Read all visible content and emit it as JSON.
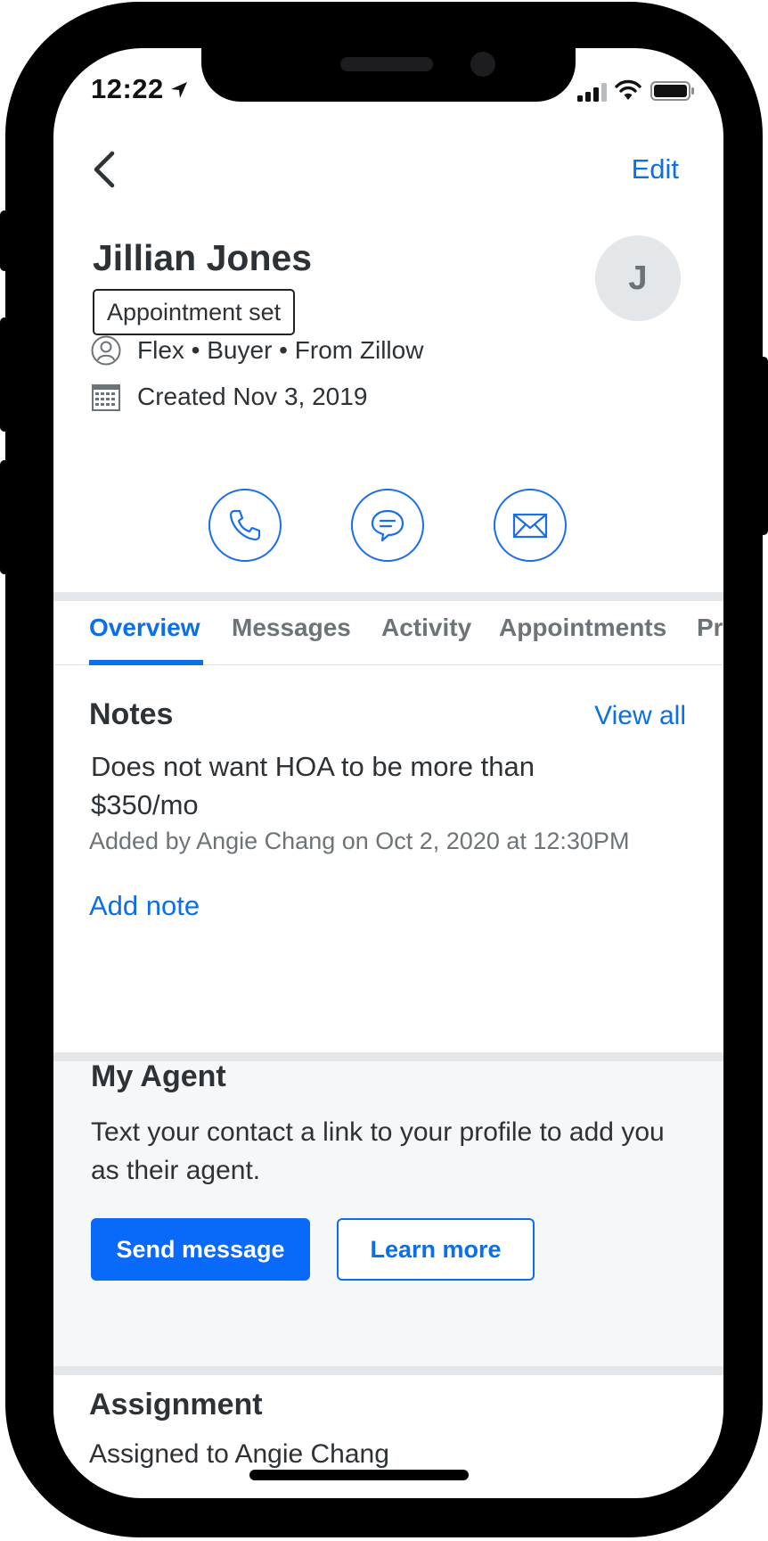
{
  "status_bar": {
    "time": "12:22"
  },
  "header": {
    "edit_label": "Edit"
  },
  "contact": {
    "name": "Jillian Jones",
    "stage": "Appointment set",
    "avatar_initial": "J",
    "source": "Flex • Buyer • From Zillow",
    "created": "Created Nov 3, 2019"
  },
  "actions": [
    {
      "name": "call",
      "icon": "phone-icon"
    },
    {
      "name": "text",
      "icon": "chat-icon"
    },
    {
      "name": "email",
      "icon": "mail-icon"
    }
  ],
  "tabs": [
    {
      "label": "Overview",
      "active": true
    },
    {
      "label": "Messages",
      "active": false
    },
    {
      "label": "Activity",
      "active": false
    },
    {
      "label": "Appointments",
      "active": false
    },
    {
      "label": "Pr",
      "active": false
    }
  ],
  "notes": {
    "title": "Notes",
    "view_all": "View all",
    "note_text": "Does not want HOA to be more than $350/mo",
    "note_meta": "Added by Angie Chang on Oct 2, 2020 at 12:30PM",
    "add_note": "Add note"
  },
  "agent": {
    "title": "My Agent",
    "description": "Text your contact a link to your profile to add you as their agent.",
    "primary_button": "Send message",
    "secondary_button": "Learn more"
  },
  "assignment": {
    "title": "Assignment",
    "assigned_text": "Assigned to Angie Chang"
  },
  "colors": {
    "accent": "#0a6fe8",
    "primary_button": "#0969f8",
    "divider": "#e3e7ea"
  }
}
